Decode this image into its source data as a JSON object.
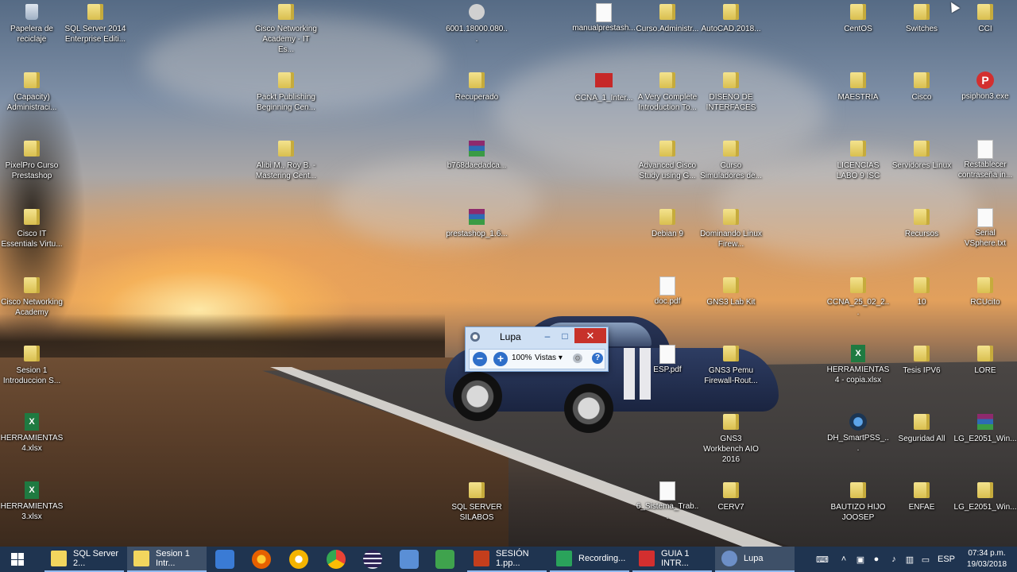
{
  "desktop": {
    "icons": [
      {
        "label": "Papelera de reciclaje",
        "type": "recycle"
      },
      {
        "label": "SQL Server 2014 Enterprise Editi...",
        "type": "folder"
      },
      {
        "label": "Cisco Networking Academy - IT Es...",
        "type": "folder"
      },
      {
        "label": "6001.18000.080...",
        "type": "appround"
      },
      {
        "label": "manualprestash...",
        "type": "doc"
      },
      {
        "label": "Curso.Administr...",
        "type": "folder"
      },
      {
        "label": "AutoCAD.2018...",
        "type": "folder"
      },
      {
        "label": "CentOS",
        "type": "folder"
      },
      {
        "label": "Switches",
        "type": "folder"
      },
      {
        "label": "CCI",
        "type": "folder"
      },
      {
        "label": "(Capacity) Administraci...",
        "type": "folder"
      },
      {
        "label": "Packt Publishing Beginning Cen...",
        "type": "folder"
      },
      {
        "label": "Recuperado",
        "type": "folder"
      },
      {
        "label": "CCNA_1_Inter...",
        "type": "redapp"
      },
      {
        "label": "A Very Complete Introduction To...",
        "type": "folder"
      },
      {
        "label": "DISENO DE INTERFACES",
        "type": "folder"
      },
      {
        "label": "MAESTRIA",
        "type": "folder"
      },
      {
        "label": "Cisco",
        "type": "folder"
      },
      {
        "label": "psiphon3.exe",
        "type": "psiphon"
      },
      {
        "label": "PixelPro Curso Prestashop",
        "type": "folder"
      },
      {
        "label": "Alibi M., Roy B. - Mastering Cent...",
        "type": "folder"
      },
      {
        "label": "b768daedadca...",
        "type": "rar"
      },
      {
        "label": "Advanced Cisco Study using G...",
        "type": "folder"
      },
      {
        "label": "Curso Simuladores de...",
        "type": "folder"
      },
      {
        "label": "LICENCIAS LABO 9 ISC",
        "type": "folder"
      },
      {
        "label": "Servidores Linux",
        "type": "folder"
      },
      {
        "label": "Restablecer contraseña in...",
        "type": "doc"
      },
      {
        "label": "Cisco IT Essentials Virtu...",
        "type": "folder"
      },
      {
        "label": "prestashop_1.6...",
        "type": "rar"
      },
      {
        "label": "Debian 9",
        "type": "folder"
      },
      {
        "label": "Dominando Linux Firew...",
        "type": "folder"
      },
      {
        "label": "Recursos",
        "type": "folder"
      },
      {
        "label": "Serial VSphere.txt",
        "type": "doc"
      },
      {
        "label": "Cisco Networking Academy",
        "type": "folder"
      },
      {
        "label": "doc.pdf",
        "type": "doc"
      },
      {
        "label": "GNS3 Lab Kit",
        "type": "folder"
      },
      {
        "label": "CCNA_25_02_2...",
        "type": "folder"
      },
      {
        "label": "10",
        "type": "folder"
      },
      {
        "label": "RCUcito",
        "type": "folder"
      },
      {
        "label": "Sesion 1 Introduccion S...",
        "type": "folder"
      },
      {
        "label": "ESP.pdf",
        "type": "doc"
      },
      {
        "label": "GNS3 Pemu Firewall-Rout...",
        "type": "folder"
      },
      {
        "label": "HERRAMIENTAS 4 - copia.xlsx",
        "type": "xls"
      },
      {
        "label": "Tesis IPV6",
        "type": "folder"
      },
      {
        "label": "LORE",
        "type": "folder"
      },
      {
        "label": "HERRAMIENTAS 4.xlsx",
        "type": "xls"
      },
      {
        "label": "GNS3 Workbench AIO 2016",
        "type": "folder"
      },
      {
        "label": "DH_SmartPSS_...",
        "type": "dahua"
      },
      {
        "label": "Seguridad All",
        "type": "folder"
      },
      {
        "label": "LG_E2051_Win...",
        "type": "rar"
      },
      {
        "label": "HERRAMIENTAS 3.xlsx",
        "type": "xls"
      },
      {
        "label": "SQL SERVER SILABOS",
        "type": "folder"
      },
      {
        "label": "6_Sistema_Trab...",
        "type": "doc"
      },
      {
        "label": "CERV7",
        "type": "folder"
      },
      {
        "label": "BAUTIZO HIJO JOOSEP",
        "type": "folder"
      },
      {
        "label": "ENFAE",
        "type": "folder"
      },
      {
        "label": "LG_E2051_Win...",
        "type": "folder"
      }
    ]
  },
  "magnifier": {
    "title": "Lupa",
    "minimize": "–",
    "maximize": "□",
    "close": "✕",
    "zoom_out": "−",
    "zoom_in": "+",
    "zoom_level": "100%",
    "views_label": "Vistas",
    "views_caret": "▾",
    "settings": "⚙",
    "help": "?"
  },
  "taskbar": {
    "tasks": [
      {
        "label": "SQL Server 2...",
        "color": "#f2d65e"
      },
      {
        "label": "Sesion 1 Intr...",
        "color": "#f2d65e"
      },
      {
        "label": "SESIÓN 1.pp...",
        "color": "#c43e1c"
      },
      {
        "label": "Recording...",
        "color": "#2aa35b"
      },
      {
        "label": "GUIA 1 INTR...",
        "color": "#d32f2f"
      },
      {
        "label": "Lupa",
        "color": "#6d8fc7"
      }
    ],
    "pinned": [
      {
        "name": "outlook-icon",
        "color": "#3a7bd5"
      },
      {
        "name": "firefox-icon",
        "color": "#e66000"
      },
      {
        "name": "chrome-canary-icon",
        "color": "#f4b400"
      },
      {
        "name": "chrome-icon",
        "color": "#34a853"
      },
      {
        "name": "eclipse-icon",
        "color": "#2c2255"
      },
      {
        "name": "network-icon",
        "color": "#5a8fd6"
      },
      {
        "name": "camtasia-icon",
        "color": "#3fa34d"
      }
    ],
    "tray": {
      "language": "ESP",
      "time": "07:34 p.m.",
      "date": "19/03/2018"
    }
  },
  "colors": {
    "taskbar_bg": "#1f3450",
    "magnifier_close": "#c7322a",
    "accent": "#2f6fc9"
  }
}
